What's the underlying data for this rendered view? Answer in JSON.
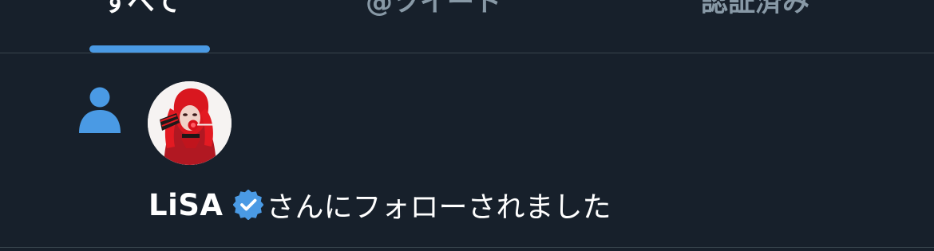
{
  "tabs": [
    {
      "label": "すべて",
      "active": true
    },
    {
      "label": "@ツイート",
      "active": false
    },
    {
      "label": "認証済み",
      "active": false
    }
  ],
  "notification": {
    "type_icon": "person-follow-icon",
    "avatar": "lisa-avatar",
    "user_name": "LiSA",
    "verified_icon": "verified-badge-icon",
    "message": "さんにフォローされました"
  },
  "colors": {
    "background": "#17202b",
    "accent": "#4a9ae4",
    "divider": "#38444d",
    "text_primary": "#ffffff",
    "text_secondary": "#8899a6"
  }
}
